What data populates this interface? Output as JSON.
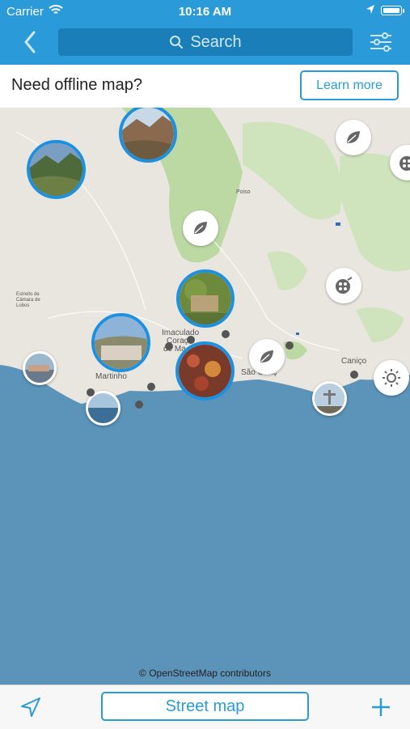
{
  "status_bar": {
    "carrier": "Carrier",
    "time": "10:16 AM"
  },
  "nav": {
    "search_label": "Search"
  },
  "banner": {
    "text": "Need offline map?",
    "button": "Learn more"
  },
  "map": {
    "attribution": "© OpenStreetMap contributors",
    "labels": [
      "Imaculado",
      "Coraç",
      "de Ma",
      "Martinho",
      "Caniço",
      "São Gonç",
      "Estreito de Câmara de Lobos",
      "Poiso"
    ]
  },
  "bottom_bar": {
    "map_type_button": "Street map"
  },
  "colors": {
    "accent": "#2a9bd8",
    "sea": "#5b93b9",
    "land": "#e9e6e0",
    "forest": "#bcd9a3"
  }
}
